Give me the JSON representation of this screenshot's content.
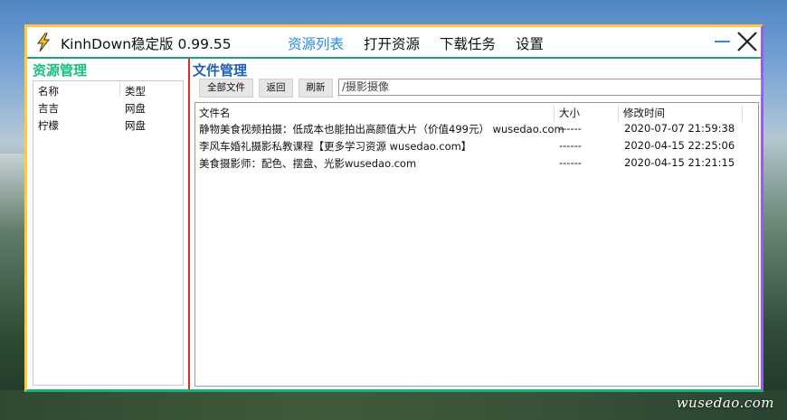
{
  "app": {
    "title": "KinhDown稳定版 0.99.55"
  },
  "nav": [
    {
      "label": "资源列表",
      "active": true
    },
    {
      "label": "打开资源",
      "active": false
    },
    {
      "label": "下载任务",
      "active": false
    },
    {
      "label": "设置",
      "active": false
    }
  ],
  "left": {
    "title": "资源管理",
    "headers": {
      "name": "名称",
      "type": "类型"
    },
    "rows": [
      {
        "name": "吉吉",
        "type": "网盘"
      },
      {
        "name": "柠檬",
        "type": "网盘"
      }
    ]
  },
  "right": {
    "title": "文件管理",
    "buttons": {
      "all": "全部文件",
      "back": "返回",
      "refresh": "刷新"
    },
    "path": "/摄影摄像",
    "headers": {
      "name": "文件名",
      "size": "大小",
      "mtime": "修改时间"
    },
    "files": [
      {
        "name": "静物美食视频拍摄：低成本也能拍出高颜值大片（价值499元） wusedao.com",
        "size": "------",
        "mtime": "2020-07-07 21:59:38"
      },
      {
        "name": "李风车婚礼摄影私教课程【更多学习资源 wusedao.com】",
        "size": "------",
        "mtime": "2020-04-15 22:25:06"
      },
      {
        "name": "美食摄影师：配色、摆盘、光影wusedao.com",
        "size": "------",
        "mtime": "2020-04-15 21:21:15"
      }
    ]
  },
  "watermark": "wusedao.com",
  "colors": {
    "accent_blue": "#2a8ce8",
    "left_title": "#18c07e",
    "right_title": "#1c5fb8",
    "divider_red": "#e02a2a"
  }
}
